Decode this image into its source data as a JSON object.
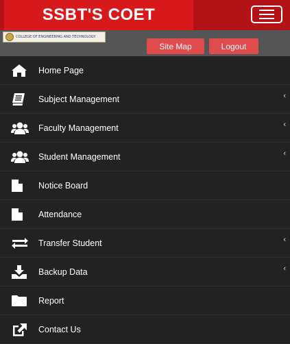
{
  "header": {
    "brand": "SSBT'S COET",
    "menu_toggle_icon": "hamburger-icon",
    "colors": {
      "brand_bg": "#d7191c",
      "bar_bg": "#b31217"
    }
  },
  "subheader": {
    "college_logo_text": "COLLEGE OF ENGINEERING AND TECHNOLOGY",
    "site_map_label": "Site Map",
    "logout_label": "Logout",
    "button_color": "#e04b4b"
  },
  "menu": {
    "expand_indicator": "‹",
    "items": [
      {
        "label": "Home Page",
        "icon": "home-icon",
        "has_submenu": false
      },
      {
        "label": "Subject Management",
        "icon": "book-icon",
        "has_submenu": true
      },
      {
        "label": "Faculty Management",
        "icon": "users-icon",
        "has_submenu": true
      },
      {
        "label": "Student Management",
        "icon": "users-icon",
        "has_submenu": true
      },
      {
        "label": "Notice Board",
        "icon": "file-icon",
        "has_submenu": false
      },
      {
        "label": "Attendance",
        "icon": "file-icon",
        "has_submenu": false
      },
      {
        "label": "Transfer Student",
        "icon": "exchange-icon",
        "has_submenu": true
      },
      {
        "label": "Backup Data",
        "icon": "download-icon",
        "has_submenu": true
      },
      {
        "label": "Report",
        "icon": "folder-icon",
        "has_submenu": false
      },
      {
        "label": "Contact Us",
        "icon": "external-link-icon",
        "has_submenu": false
      }
    ]
  }
}
